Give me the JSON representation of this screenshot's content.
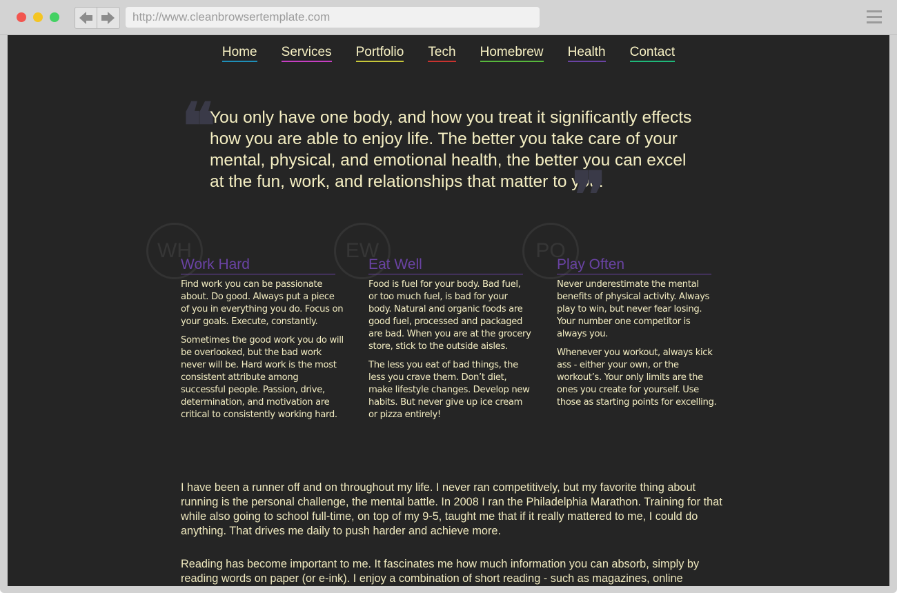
{
  "browser": {
    "url": "http://www.cleanbrowsertemplate.com",
    "icons": [
      "close-dot",
      "minimize-dot",
      "maximize-dot",
      "back-arrow-icon",
      "forward-arrow-icon",
      "hamburger-menu-icon"
    ]
  },
  "nav": [
    {
      "label": "Home",
      "color": "#1f8fb8"
    },
    {
      "label": "Services",
      "color": "#c63fc2"
    },
    {
      "label": "Portfolio",
      "color": "#c8c83a"
    },
    {
      "label": "Tech",
      "color": "#c8332f"
    },
    {
      "label": "Homebrew",
      "color": "#57b83c"
    },
    {
      "label": "Health",
      "color": "#6a43a4"
    },
    {
      "label": "Contact",
      "color": "#1fb87a"
    }
  ],
  "quote": {
    "text": "You only have one body, and how you treat it significantly effects how you are able to enjoy life. The better you take care of your mental, physical, and emotional health, the better you can excel at the fun, work, and relationships that matter to you."
  },
  "columns": [
    {
      "mono": "WH",
      "title": "Work Hard",
      "p1": "Find work you can be passionate about. Do good. Always put a piece of you in everything you do. Focus on your goals. Execute, constantly.",
      "p2": "Sometimes the good work you do will be overlooked, but the bad work never will be. Hard work is the most consistent attribute among successful people. Passion, drive, determination, and motivation are critical to consistently working hard."
    },
    {
      "mono": "EW",
      "title": "Eat Well",
      "p1": "Food is fuel for your body. Bad fuel, or too much fuel, is bad for your body. Natural and organic foods are good fuel, processed and packaged are bad. When you are at the grocery store, stick to the outside aisles.",
      "p2": "The less you eat of bad things, the less you crave them. Don’t diet, make lifestyle changes. Develop new habits. But never give up ice cream or pizza entirely!"
    },
    {
      "mono": "PO",
      "title": "Play Often",
      "p1": "Never underestimate the mental benefits of physical activity. Always play to win, but never fear losing. Your number one competitor is always you.",
      "p2": "Whenever you workout, always kick ass - either your own, or the workout’s. Your only limits are the ones you create for yourself. Use those as starting points for excelling."
    }
  ],
  "paragraphs": [
    "I have been a runner off and on throughout my life. I never ran competitively, but my favorite thing about running is the personal challenge, the mental battle. In 2008 I ran the Philadelphia Marathon. Training for that while also going to school full-time, on top of my 9-5, taught me that if it really mattered to me, I could do anything. That drives me daily to push harder and achieve more.",
    "Reading has become important to me. It fascinates me how much information you can absorb, simply by reading words on paper (or e-ink). I enjoy a combination of short reading - such as magazines, online"
  ]
}
